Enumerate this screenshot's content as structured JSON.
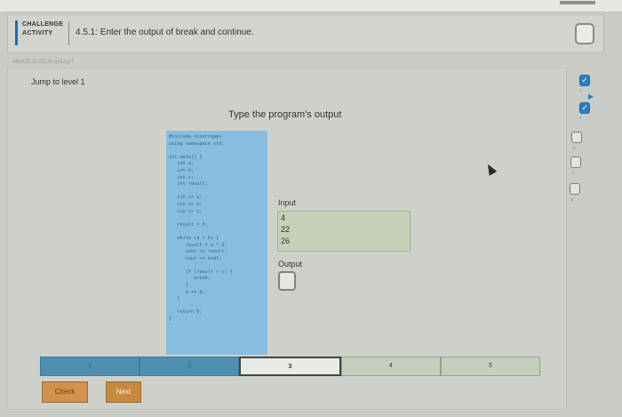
{
  "header": {
    "badge_line1": "CHALLENGE",
    "badge_line2": "ACTIVITY",
    "title": "4.5.1: Enter the output of break and continue."
  },
  "activity_id": "489420.3102134.qx3zqy7",
  "jump_label": "Jump to level 1",
  "prompt": "Type the program's output",
  "code_lines": [
    "#include <iostream>",
    "using namespace std;",
    "",
    "int main() {",
    "   int a;",
    "   int b;",
    "   int c;",
    "   int result;",
    "",
    "   cin >> a;",
    "   cin >> b;",
    "   cin >> c;",
    "",
    "   result = 0;",
    "",
    "   while (a < b) {",
    "      result = a * 2;",
    "      cout << result;",
    "      cout << endl;",
    "",
    "      if (result > c) {",
    "         break;",
    "      }",
    "      a += 4;",
    "   }",
    "",
    "   return 0;",
    "}"
  ],
  "io": {
    "input_label": "Input",
    "input_values": [
      "4",
      "22",
      "26"
    ],
    "output_label": "Output"
  },
  "progress": {
    "segments": [
      "1",
      "2",
      "3",
      "4",
      "5"
    ],
    "current": "3"
  },
  "buttons": {
    "check": "Check",
    "next": "Next"
  },
  "levels": [
    {
      "num": "1",
      "state": "done"
    },
    {
      "num": "2",
      "state": "done"
    },
    {
      "num": "3",
      "state": "todo"
    },
    {
      "num": "4",
      "state": "todo"
    },
    {
      "num": "5",
      "state": "todo"
    }
  ],
  "colors": {
    "accent": "#2b7ec0",
    "check_button": "#d1924d",
    "code_bg": "#87bedf",
    "progress_done": "#4f8fb0"
  },
  "icons": [
    "check-icon",
    "cursor-icon",
    "chevron-right-icon"
  ]
}
